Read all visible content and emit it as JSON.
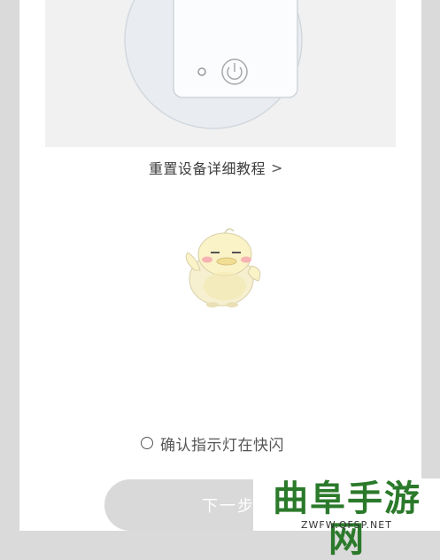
{
  "reset_tutorial": {
    "label": "重置设备详细教程",
    "chevron": ">"
  },
  "confirm": {
    "label": "确认指示灯在快闪",
    "checked": false
  },
  "next_button": {
    "label": "下一步"
  },
  "watermark": {
    "title": "曲阜手游网",
    "url": "ZWFW.QFSP.NET"
  },
  "illustration": {
    "icons": [
      "device-illustration",
      "power-icon",
      "indicator-light-icon"
    ]
  },
  "mascot": {
    "icon": "duck-mascot-icon"
  },
  "colors": {
    "panel": "#f1f1f1",
    "button": "#d9d9d9",
    "watermark_green": "#2b7a2b"
  }
}
